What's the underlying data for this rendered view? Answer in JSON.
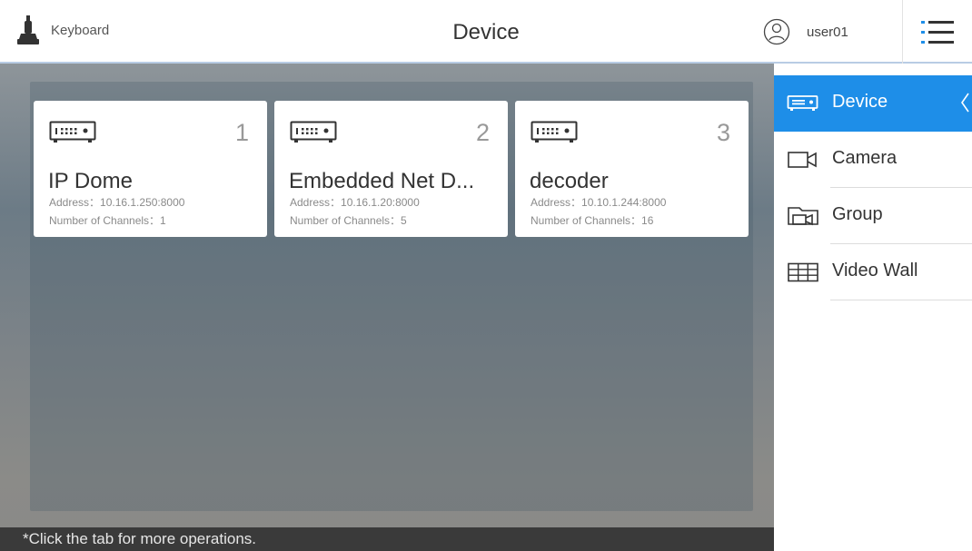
{
  "header": {
    "keyboard_label": "Keyboard",
    "title": "Device",
    "username": "user01"
  },
  "devices": [
    {
      "number": "1",
      "name": "IP Dome",
      "address": "Address：10.16.1.250:8000",
      "channels": "Number of Channels：1"
    },
    {
      "number": "2",
      "name": "Embedded Net D...",
      "address": "Address：10.16.1.20:8000",
      "channels": "Number of Channels：5"
    },
    {
      "number": "3",
      "name": "decoder",
      "address": "Address：10.10.1.244:8000",
      "channels": "Number of Channels：16"
    }
  ],
  "hint": "*Click the tab for more operations.",
  "sidebar": {
    "items": [
      {
        "label": "Device",
        "icon": "device-icon",
        "active": true
      },
      {
        "label": "Camera",
        "icon": "camera-icon",
        "active": false
      },
      {
        "label": "Group",
        "icon": "group-icon",
        "active": false
      },
      {
        "label": "Video Wall",
        "icon": "video-wall-icon",
        "active": false
      }
    ]
  },
  "colors": {
    "accent": "#1e8ee8",
    "header_border": "#b8cce4"
  }
}
